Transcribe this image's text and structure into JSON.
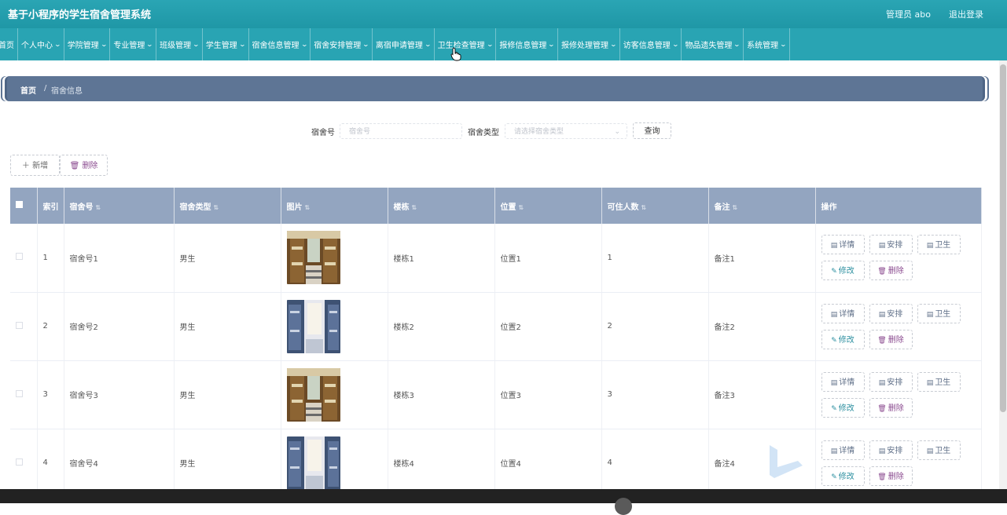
{
  "header": {
    "title": "基于小程序的学生宿舍管理系统",
    "admin": "管理员 abo",
    "logout": "退出登录"
  },
  "nav": {
    "items": [
      {
        "label": "首页",
        "has_menu": false
      },
      {
        "label": "个人中心",
        "has_menu": true
      },
      {
        "label": "学院管理",
        "has_menu": true
      },
      {
        "label": "专业管理",
        "has_menu": true
      },
      {
        "label": "班级管理",
        "has_menu": true
      },
      {
        "label": "学生管理",
        "has_menu": true
      },
      {
        "label": "宿舍信息管理",
        "has_menu": true
      },
      {
        "label": "宿舍安排管理",
        "has_menu": true
      },
      {
        "label": "离宿申请管理",
        "has_menu": true
      },
      {
        "label": "卫生检查管理",
        "has_menu": true
      },
      {
        "label": "报修信息管理",
        "has_menu": true
      },
      {
        "label": "报修处理管理",
        "has_menu": true
      },
      {
        "label": "访客信息管理",
        "has_menu": true
      },
      {
        "label": "物品遗失管理",
        "has_menu": true
      },
      {
        "label": "系统管理",
        "has_menu": true
      }
    ]
  },
  "breadcrumb": {
    "home": "首页",
    "separator": "/",
    "current": "宿舍信息"
  },
  "search": {
    "dorm_no_label": "宿舍号",
    "dorm_no_placeholder": "宿舍号",
    "dorm_type_label": "宿舍类型",
    "dorm_type_placeholder": "请选择宿舍类型",
    "query_label": "查询"
  },
  "toolbar": {
    "add_label": "新增",
    "delete_label": "删除"
  },
  "table": {
    "columns": [
      "索引",
      "宿舍号",
      "宿舍类型",
      "图片",
      "楼栋",
      "位置",
      "可住人数",
      "备注",
      "操作"
    ],
    "rows": [
      {
        "index": "1",
        "dorm_no": "宿舍号1",
        "type": "男生",
        "building": "楼栋1",
        "location": "位置1",
        "capacity": "1",
        "remark": "备注1",
        "img": "bunk-warm"
      },
      {
        "index": "2",
        "dorm_no": "宿舍号2",
        "type": "男生",
        "building": "楼栋2",
        "location": "位置2",
        "capacity": "2",
        "remark": "备注2",
        "img": "bunk-blue"
      },
      {
        "index": "3",
        "dorm_no": "宿舍号3",
        "type": "男生",
        "building": "楼栋3",
        "location": "位置3",
        "capacity": "3",
        "remark": "备注3",
        "img": "bunk-warm"
      },
      {
        "index": "4",
        "dorm_no": "宿舍号4",
        "type": "男生",
        "building": "楼栋4",
        "location": "位置4",
        "capacity": "4",
        "remark": "备注4",
        "img": "bunk-blue"
      }
    ],
    "actions": {
      "detail": "详情",
      "arrange": "安排",
      "hygiene": "卫生",
      "edit": "修改",
      "delete": "删除"
    }
  },
  "colors": {
    "topbar": "#2aa5b4",
    "navbar": "#29a4b3",
    "breadcrumb": "#5e7595",
    "table_header": "#93a5c0"
  }
}
